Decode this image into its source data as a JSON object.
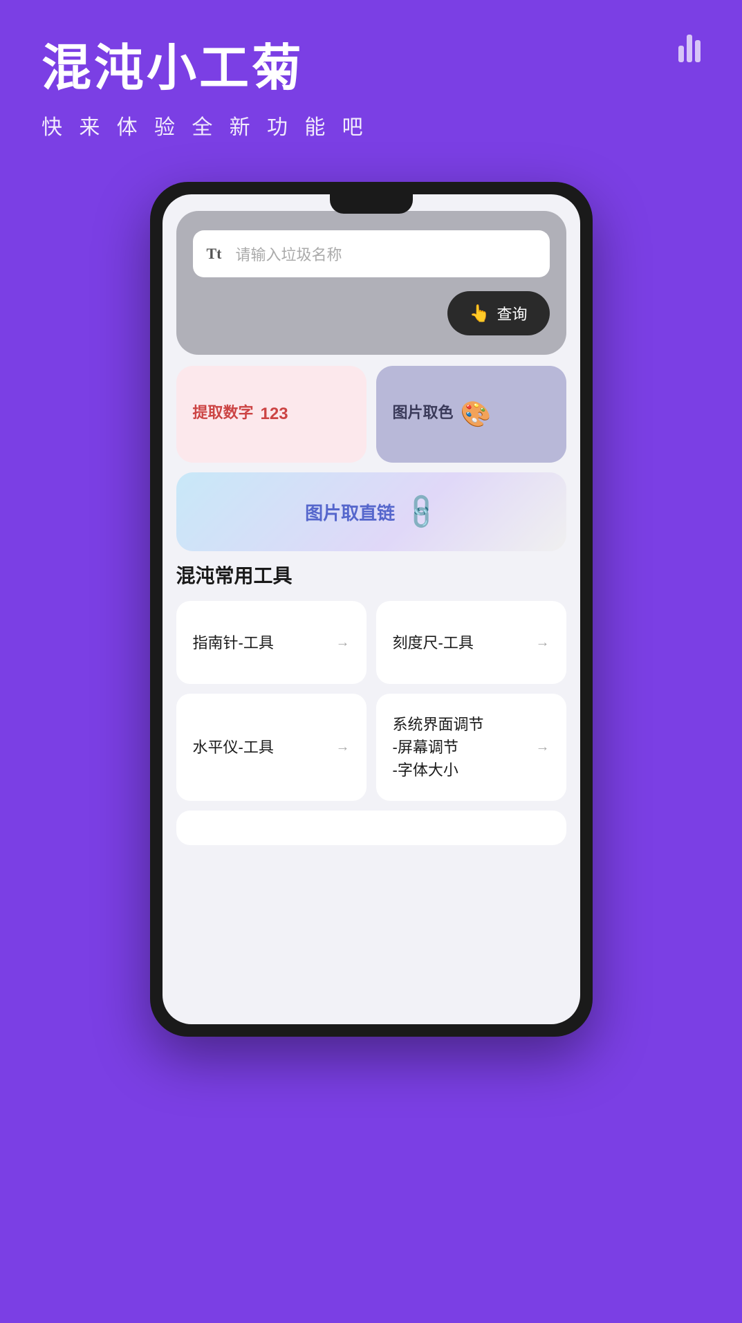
{
  "header": {
    "title": "混沌小工菊",
    "subtitle": "快 来 体 验 全 新 功 能 吧",
    "icon_label": "chart-bars-icon"
  },
  "phone": {
    "search_widget": {
      "placeholder": "请输入垃圾名称",
      "tt_label": "Tt",
      "button_label": "查询"
    },
    "card_extract": {
      "label": "提取数字",
      "icon": "123"
    },
    "card_color": {
      "label": "图片取色"
    },
    "card_link": {
      "label": "图片取直链"
    },
    "tools_section": {
      "title": "混沌常用工具",
      "tools": [
        {
          "label": "指南针-工具",
          "arrow": "→"
        },
        {
          "label": "刻度尺-工具",
          "arrow": "→"
        },
        {
          "label": "水平仪-工具",
          "arrow": "→"
        },
        {
          "label": "系统界面调节\n-屏幕调节\n-字体大小",
          "arrow": "→"
        }
      ]
    }
  }
}
